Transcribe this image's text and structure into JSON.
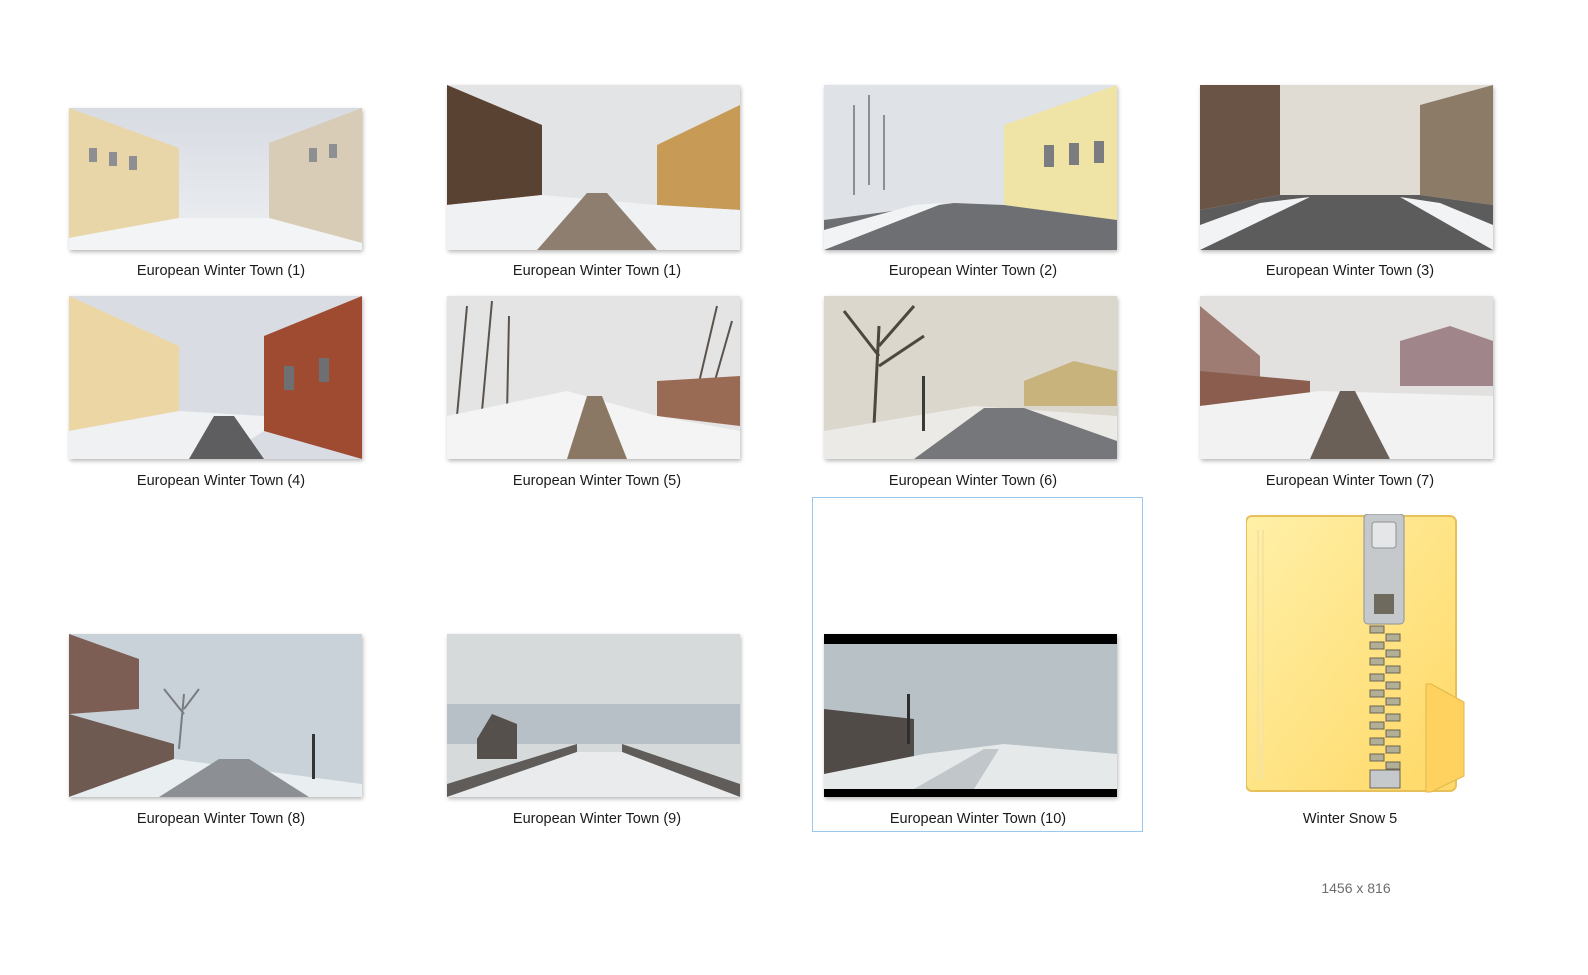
{
  "files": [
    {
      "id": "ewt-1a",
      "label": "European Winter Town (1)",
      "scene": "yellow-houses-left"
    },
    {
      "id": "ewt-1b",
      "label": "European Winter Town (1)",
      "scene": "cobblestone-wood"
    },
    {
      "id": "ewt-2",
      "label": "European Winter Town (2)",
      "scene": "yellow-row-right"
    },
    {
      "id": "ewt-3",
      "label": "European Winter Town (3)",
      "scene": "stone-street"
    },
    {
      "id": "ewt-4",
      "label": "European Winter Town (4)",
      "scene": "red-building"
    },
    {
      "id": "ewt-5",
      "label": "European Winter Town (5)",
      "scene": "trees-path"
    },
    {
      "id": "ewt-6",
      "label": "European Winter Town (6)",
      "scene": "big-tree-lamp"
    },
    {
      "id": "ewt-7",
      "label": "European Winter Town (7)",
      "scene": "village-road"
    },
    {
      "id": "ewt-8",
      "label": "European Winter Town (8)",
      "scene": "foggy-wall"
    },
    {
      "id": "ewt-9",
      "label": "European Winter Town (9)",
      "scene": "hill-road"
    },
    {
      "id": "ewt-10",
      "label": "European Winter Town (10)",
      "scene": "letterbox-road",
      "selected": true
    },
    {
      "id": "winter-snow-5",
      "label": "Winter Snow 5",
      "icon": "zip-folder-icon"
    }
  ],
  "selection_info": "1456 x 816",
  "colors": {
    "selection_border": "#99c9ef",
    "folder_yellow": "#ffe38a",
    "zipper_silver": "#c9ccd0"
  }
}
